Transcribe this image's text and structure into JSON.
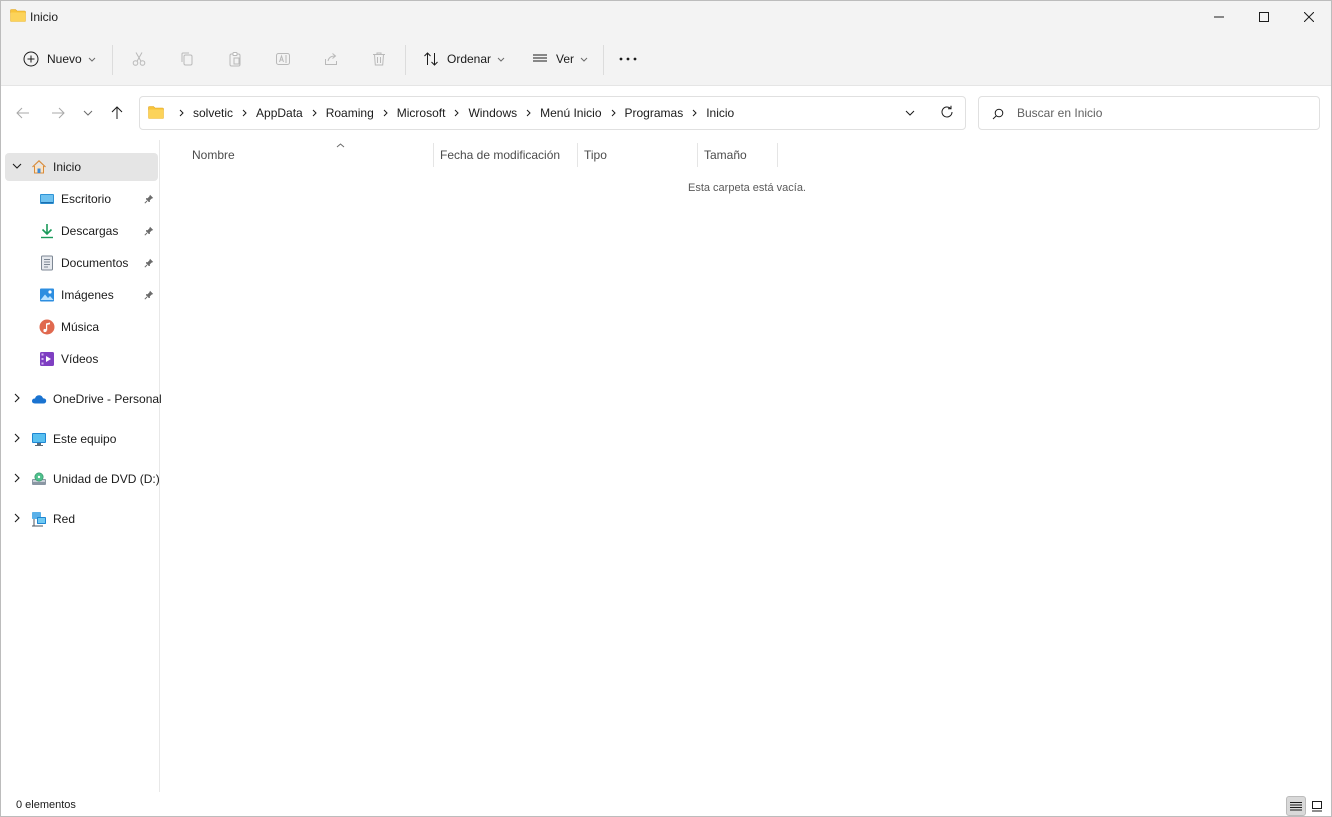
{
  "window": {
    "title": "Inicio",
    "controls": {
      "minimize": "minimize",
      "maximize": "maximize",
      "close": "close"
    }
  },
  "toolbar": {
    "new_label": "Nuevo",
    "sort_label": "Ordenar",
    "view_label": "Ver",
    "icons": [
      "cut-icon",
      "copy-icon",
      "paste-icon",
      "rename-icon",
      "share-icon",
      "delete-icon",
      "more-icon"
    ]
  },
  "address": {
    "crumbs": [
      "solvetic",
      "AppData",
      "Roaming",
      "Microsoft",
      "Windows",
      "Menú Inicio",
      "Programas",
      "Inicio"
    ]
  },
  "search": {
    "placeholder": "Buscar en Inicio"
  },
  "sidebar": {
    "home": "Inicio",
    "quick_access": [
      {
        "label": "Escritorio",
        "pinned": true
      },
      {
        "label": "Descargas",
        "pinned": true
      },
      {
        "label": "Documentos",
        "pinned": true
      },
      {
        "label": "Imágenes",
        "pinned": true
      },
      {
        "label": "Música",
        "pinned": false
      },
      {
        "label": "Vídeos",
        "pinned": false
      }
    ],
    "locations": [
      {
        "label": "OneDrive - Personal"
      },
      {
        "label": "Este equipo"
      },
      {
        "label": "Unidad de DVD (D:)"
      },
      {
        "label": "Red"
      }
    ]
  },
  "columns": {
    "name": "Nombre",
    "modified": "Fecha de modificación",
    "type": "Tipo",
    "size": "Tamaño"
  },
  "content": {
    "empty_message": "Esta carpeta está vacía."
  },
  "status": {
    "item_count": "0 elementos"
  },
  "colors": {
    "accent": "#0067c0",
    "folder": "#f8c43a",
    "selected_bg": "#e5e5e5",
    "chrome_bg": "#f3f3f3"
  }
}
